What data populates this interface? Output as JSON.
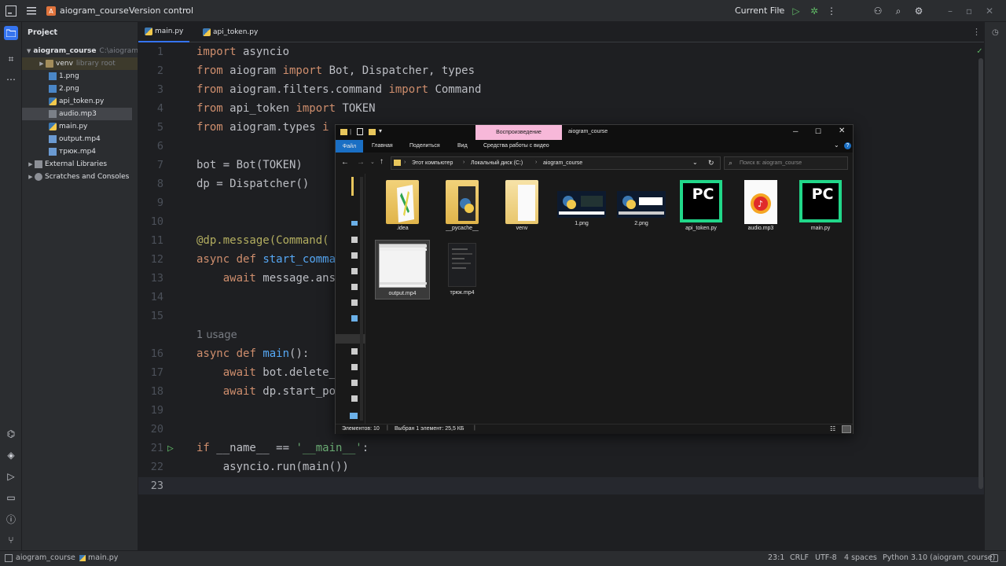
{
  "titlebar": {
    "project_badge": "A",
    "project_name": "aiogram_course",
    "vcs": "Version control",
    "run_config": "Current File"
  },
  "project_panel": {
    "title": "Project",
    "root_name": "aiogram_course",
    "root_path": "C:\\aiogram",
    "items": [
      {
        "label": "venv",
        "note": "library root"
      },
      {
        "label": "1.png"
      },
      {
        "label": "2.png"
      },
      {
        "label": "api_token.py"
      },
      {
        "label": "audio.mp3"
      },
      {
        "label": "main.py"
      },
      {
        "label": "output.mp4"
      },
      {
        "label": "трюк.mp4"
      },
      {
        "label": "External Libraries"
      },
      {
        "label": "Scratches and Consoles"
      }
    ]
  },
  "tabs": [
    {
      "label": "main.py"
    },
    {
      "label": "api_token.py"
    }
  ],
  "editor": {
    "line_numbers": [
      "1",
      "2",
      "3",
      "4",
      "5",
      "6",
      "7",
      "8",
      "9",
      "10",
      "11",
      "12",
      "13",
      "14",
      "15",
      "16",
      "17",
      "18",
      "19",
      "20",
      "21",
      "22",
      "23"
    ],
    "usage_hint": "1 usage",
    "tokens": {
      "import": "import",
      "from": "from",
      "async": "async",
      "def": "def",
      "await": "await",
      "if": "if",
      "l1": " asyncio",
      "l2a": " aiogram ",
      "l2b": " Bot, Dispatcher, types",
      "l3a": " aiogram.filters.command ",
      "l3b": " Command",
      "l4a": " api_token ",
      "l4b": " TOKEN",
      "l5a": " aiogram.types ",
      "l5b": "i",
      "l7": "bot = Bot(TOKEN)",
      "l8": "dp = Dispatcher()",
      "l11": "@dp.message(Command(",
      "l12": "start_comma",
      "l13": " message.ans",
      "l16a": "main",
      "l16b": "():",
      "l17": " bot.delete_",
      "l18": " dp.start_po",
      "l21a": " __name__ == ",
      "l21b": "'__main__'",
      "l21c": ":",
      "l22": "asyncio.run(main())"
    }
  },
  "explorer": {
    "play_tab": "Воспроизведение",
    "title": "aiogram_course",
    "ribbon": [
      "Файл",
      "Главная",
      "Поделиться",
      "Вид",
      "Средства работы с видео"
    ],
    "breadcrumb": [
      "Этот компьютер",
      "Локальный диск (C:)",
      "aiogram_course"
    ],
    "search_placeholder": "Поиск в: aiogram_course",
    "files": [
      {
        "label": ".idea"
      },
      {
        "label": "__pycache__"
      },
      {
        "label": "venv"
      },
      {
        "label": "1.png"
      },
      {
        "label": "2.png"
      },
      {
        "label": "api_token.py"
      },
      {
        "label": "audio.mp3"
      },
      {
        "label": "main.py"
      },
      {
        "label": "output.mp4"
      },
      {
        "label": "трюк.mp4"
      }
    ],
    "status_count": "Элементов: 10",
    "status_selected": "Выбран 1 элемент: 25,5 КБ",
    "pc_text": "PC"
  },
  "statusbar": {
    "crumb_project": "aiogram_course",
    "crumb_file": "main.py",
    "position": "23:1",
    "line_sep": "CRLF",
    "encoding": "UTF-8",
    "indent": "4 spaces",
    "interpreter": "Python 3.10 (aiogram_course)"
  },
  "colors": {
    "accent": "#3574f0",
    "keyword": "#cf8e6d",
    "function": "#56a8f5",
    "string": "#6aab73",
    "decorator": "#b3ae60",
    "pycharm_green": "#21d789"
  }
}
